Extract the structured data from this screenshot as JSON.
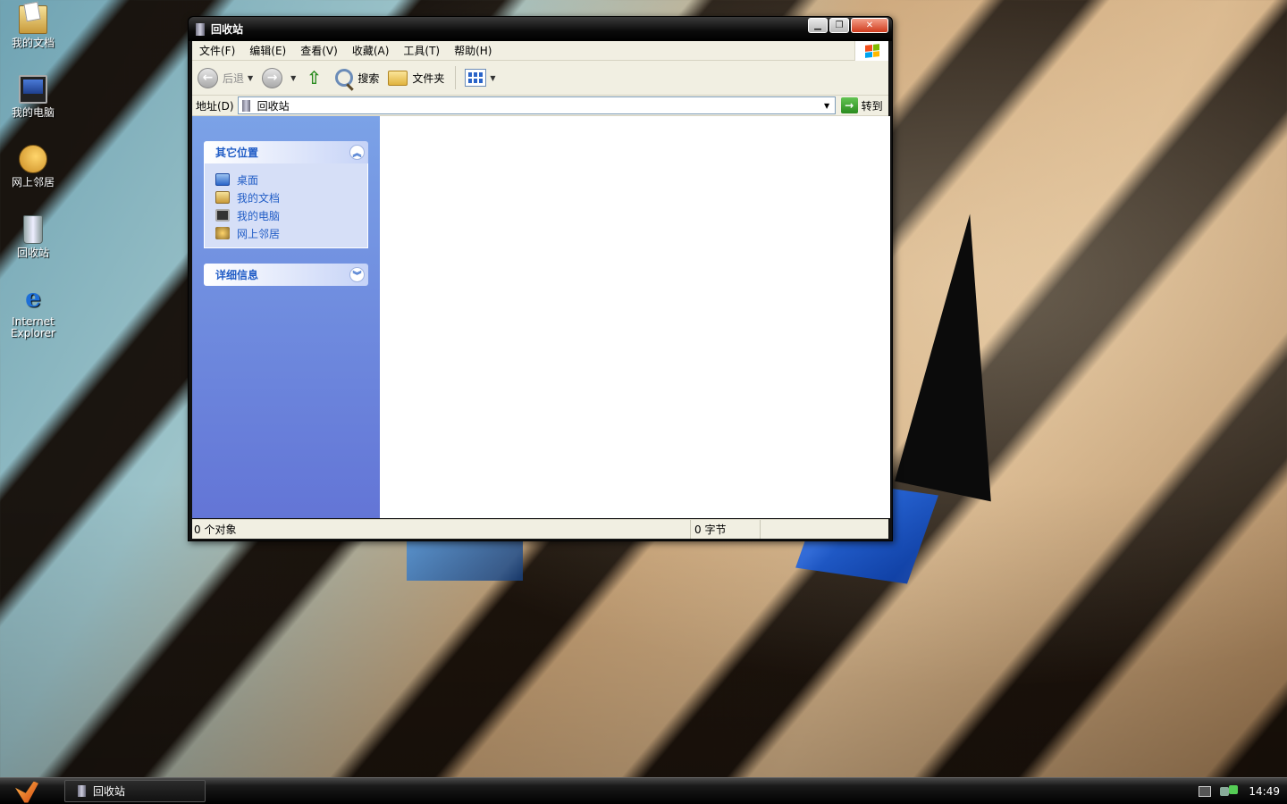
{
  "desktop": {
    "icons": [
      {
        "label": "我的文档",
        "icon": "my-documents-icon"
      },
      {
        "label": "我的电脑",
        "icon": "my-computer-icon"
      },
      {
        "label": "网上邻居",
        "icon": "network-places-icon"
      },
      {
        "label": "回收站",
        "icon": "recycle-bin-icon"
      },
      {
        "label": "Internet Explorer",
        "icon": "internet-explorer-icon"
      }
    ]
  },
  "window": {
    "title": "回收站",
    "menu": [
      "文件(F)",
      "编辑(E)",
      "查看(V)",
      "收藏(A)",
      "工具(T)",
      "帮助(H)"
    ],
    "toolbar": {
      "back": "后退",
      "search": "搜索",
      "folders": "文件夹"
    },
    "address": {
      "label": "地址(D)",
      "value": "回收站",
      "go": "转到"
    },
    "tasks": {
      "other_places": {
        "title": "其它位置",
        "items": [
          "桌面",
          "我的文档",
          "我的电脑",
          "网上邻居"
        ]
      },
      "details": {
        "title": "详细信息"
      }
    },
    "status": {
      "objects": "0 个对象",
      "size": "0 字节"
    }
  },
  "taskbar": {
    "items": [
      "回收站"
    ],
    "clock": "14:49"
  }
}
